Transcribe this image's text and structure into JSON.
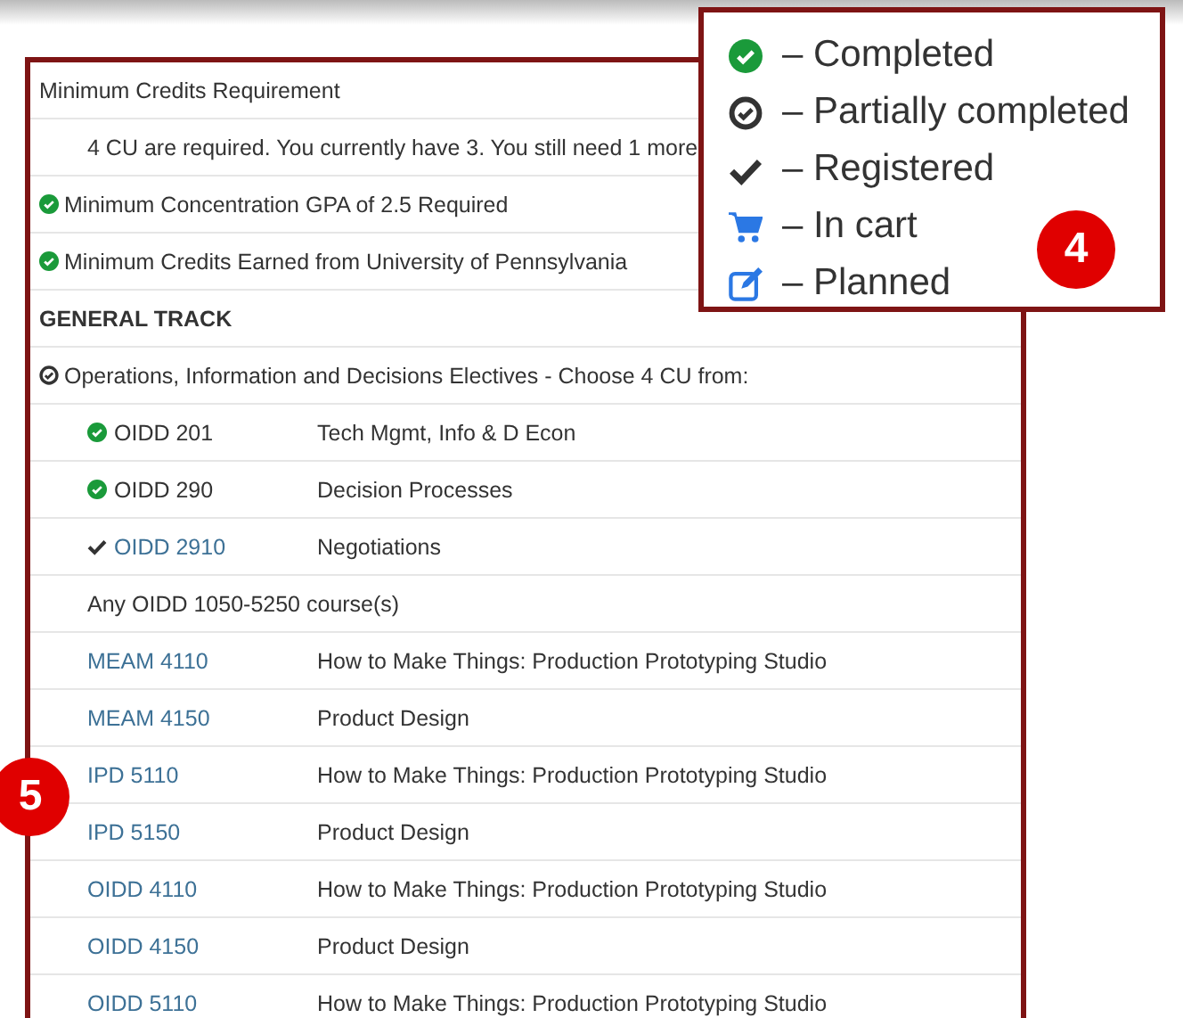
{
  "requirements": [
    {
      "kind": "heading",
      "completed": false,
      "partially_completed": false,
      "label": "Minimum Credits Requirement"
    },
    {
      "kind": "note",
      "completed": false,
      "partially_completed": false,
      "label": "4 CU are required. You currently have 3. You still need 1 more"
    },
    {
      "kind": "heading",
      "completed": true,
      "partially_completed": false,
      "label": "Minimum Concentration GPA of 2.5 Required"
    },
    {
      "kind": "heading",
      "completed": true,
      "partially_completed": false,
      "label": "Minimum Credits Earned from University of Pennsylvania"
    },
    {
      "kind": "section",
      "completed": false,
      "partially_completed": false,
      "label": "GENERAL TRACK"
    },
    {
      "kind": "heading",
      "completed": false,
      "partially_completed": true,
      "label": "Operations, Information and Decisions Electives - Choose 4 CU from:"
    }
  ],
  "courses": [
    {
      "kind": "course",
      "completed": true,
      "registered": false,
      "link": false,
      "code": "OIDD 201",
      "title": "Tech Mgmt, Info & D Econ"
    },
    {
      "kind": "course",
      "completed": true,
      "registered": false,
      "link": false,
      "code": "OIDD 290",
      "title": "Decision Processes"
    },
    {
      "kind": "course",
      "completed": false,
      "registered": true,
      "link": true,
      "code": "OIDD 2910",
      "title": "Negotiations"
    },
    {
      "kind": "range",
      "completed": false,
      "registered": false,
      "link": false,
      "code": "Any OIDD 1050-5250 course(s)"
    },
    {
      "kind": "course",
      "completed": false,
      "registered": false,
      "link": true,
      "code": "MEAM 4110",
      "title": "How to Make Things: Production Prototyping Studio"
    },
    {
      "kind": "course",
      "completed": false,
      "registered": false,
      "link": true,
      "code": "MEAM 4150",
      "title": "Product Design"
    },
    {
      "kind": "course",
      "completed": false,
      "registered": false,
      "link": true,
      "code": "IPD 5110",
      "title": "How to Make Things: Production Prototyping Studio"
    },
    {
      "kind": "course",
      "completed": false,
      "registered": false,
      "link": true,
      "code": "IPD 5150",
      "title": "Product Design"
    },
    {
      "kind": "course",
      "completed": false,
      "registered": false,
      "link": true,
      "code": "OIDD 4110",
      "title": "How to Make Things: Production Prototyping Studio"
    },
    {
      "kind": "course",
      "completed": false,
      "registered": false,
      "link": true,
      "code": "OIDD 4150",
      "title": "Product Design"
    },
    {
      "kind": "course",
      "completed": false,
      "registered": false,
      "link": true,
      "code": "OIDD 5110",
      "title": "How to Make Things: Production Prototyping Studio"
    }
  ],
  "legend": [
    {
      "kind": "completed",
      "label": "– Completed"
    },
    {
      "kind": "partial",
      "label": "– Partially completed"
    },
    {
      "kind": "registered",
      "label": "– Registered"
    },
    {
      "kind": "cart",
      "label": "– In cart"
    },
    {
      "kind": "planned",
      "label": "– Planned"
    }
  ],
  "callouts": [
    {
      "kind": "legend",
      "number": "4"
    },
    {
      "kind": "list",
      "number": "5"
    }
  ]
}
